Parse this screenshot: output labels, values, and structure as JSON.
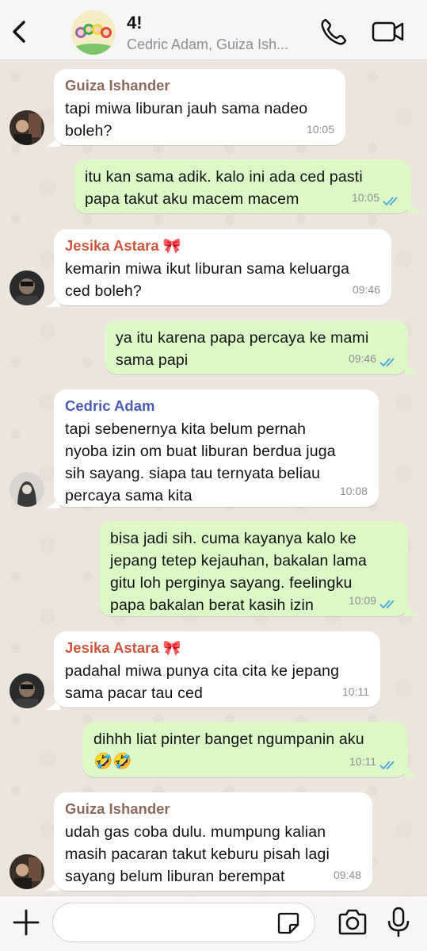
{
  "header": {
    "title": "4!",
    "subtitle": "Cedric Adam, Guiza Ish..."
  },
  "messages": [
    {
      "direction": "in",
      "sender": "Guiza Ishander",
      "sender_color": "#8a6a5a",
      "text": "tapi miwa liburan jauh sama nadeo\nboleh?",
      "time": "10:05"
    },
    {
      "direction": "out",
      "text": "itu kan sama adik. kalo ini ada ced pasti\npapa takut aku macem macem",
      "time": "10:05"
    },
    {
      "direction": "in",
      "sender": "Jesika Astara 🎀",
      "sender_color": "#c9573e",
      "text": "kemarin miwa ikut liburan sama keluarga\nced boleh?",
      "time": "09:46"
    },
    {
      "direction": "out",
      "text": "ya itu karena papa percaya ke mami\nsama papi",
      "time": "09:46"
    },
    {
      "direction": "in",
      "sender": "Cedric Adam",
      "sender_color": "#4a5db0",
      "text": "tapi sebenernya kita belum pernah\nnyoba izin om buat liburan berdua juga\nsih sayang. siapa tau ternyata beliau\npercaya sama kita",
      "time": "10:08"
    },
    {
      "direction": "out",
      "text": "bisa jadi sih. cuma kayanya kalo ke\njepang tetep kejauhan, bakalan lama\ngitu loh perginya sayang. feelingku\npapa bakalan berat kasih izin",
      "time": "10:09"
    },
    {
      "direction": "in",
      "sender": "Jesika Astara 🎀",
      "sender_color": "#c9573e",
      "text": "padahal miwa punya cita cita ke jepang\nsama pacar tau ced",
      "time": "10:11"
    },
    {
      "direction": "out",
      "text": "dihhh liat pinter banget ngumpanin aku\n🤣🤣",
      "time": "10:11"
    },
    {
      "direction": "in",
      "sender": "Guiza Ishander",
      "sender_color": "#8a6a5a",
      "text": "udah gas coba dulu. mumpung kalian\nmasih pacaran takut keburu pisah lagi\nsayang belum liburan berempat",
      "time": "09:48"
    }
  ],
  "colors": {
    "tick_read": "#4fa3e0",
    "icon": "#111111"
  },
  "input": {
    "placeholder": "",
    "value": ""
  }
}
